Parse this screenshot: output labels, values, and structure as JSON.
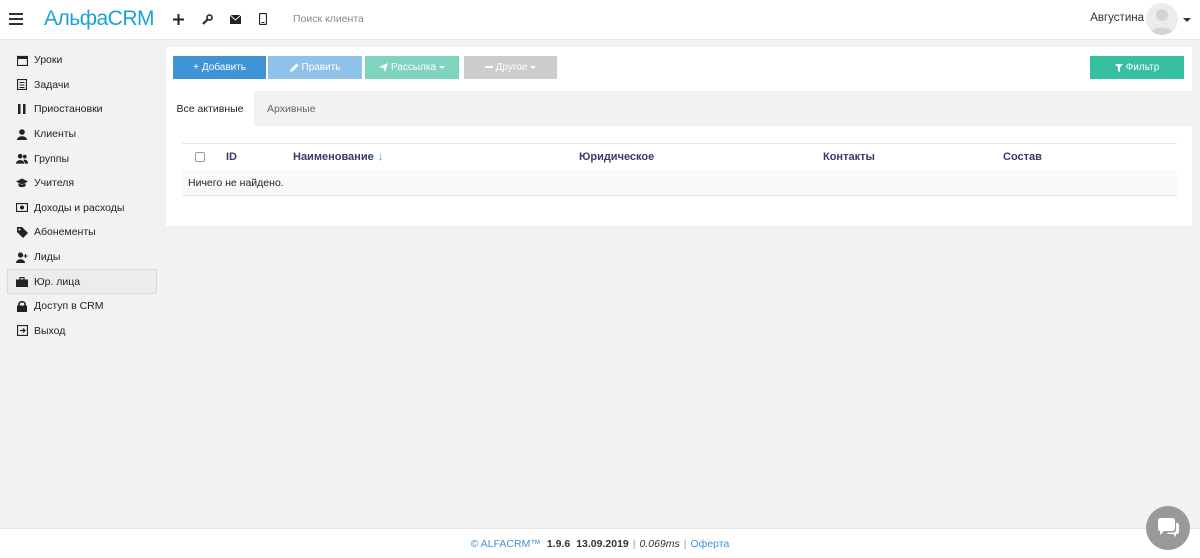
{
  "topbar": {
    "logo": "АльфаCRM",
    "search_placeholder": "Поиск клиента",
    "user_name": "Августина",
    "icons": [
      "plus-icon",
      "wrench-icon",
      "envelope-icon",
      "mobile-icon"
    ]
  },
  "sidebar": {
    "items": [
      {
        "label": "Уроки",
        "icon": "calendar-icon"
      },
      {
        "label": "Задачи",
        "icon": "tasks-icon"
      },
      {
        "label": "Приостановки",
        "icon": "pause-icon"
      },
      {
        "label": "Клиенты",
        "icon": "user-icon"
      },
      {
        "label": "Группы",
        "icon": "users-icon"
      },
      {
        "label": "Учителя",
        "icon": "graduation-cap-icon"
      },
      {
        "label": "Доходы и расходы",
        "icon": "money-icon"
      },
      {
        "label": "Абонементы",
        "icon": "tag-icon"
      },
      {
        "label": "Лиды",
        "icon": "user-plus-icon"
      },
      {
        "label": "Юр. лица",
        "icon": "briefcase-icon"
      },
      {
        "label": "Доступ в CRM",
        "icon": "lock-icon"
      },
      {
        "label": "Выход",
        "icon": "sign-out-icon"
      }
    ],
    "active_index": 9
  },
  "toolbar": {
    "add_label": "Добавить",
    "edit_label": "Править",
    "mail_label": "Рассылка",
    "other_label": "Другое",
    "filter_label": "Фильтр"
  },
  "tabs": {
    "active_label": "Все активные",
    "archive_label": "Архивные"
  },
  "table": {
    "columns": [
      "ID",
      "Наименование",
      "Юридическое",
      "Контакты",
      "Состав"
    ],
    "sort_indicator": "↓",
    "empty_text": "Ничего не найдено."
  },
  "footer": {
    "brand": "© ALFACRM™",
    "version": "1.9.6",
    "date": "13.09.2019",
    "separator": "|",
    "time": "0.069ms",
    "link": "Оферта"
  },
  "colors": {
    "logo": "#1aa3d9",
    "add_button": "#3e94d4",
    "edit_button": "#8fc2ea",
    "mail_button": "#7fd4bd",
    "other_button": "#cccccc",
    "filter_button": "#36bfa1",
    "header_text": "#3a3a6a"
  }
}
